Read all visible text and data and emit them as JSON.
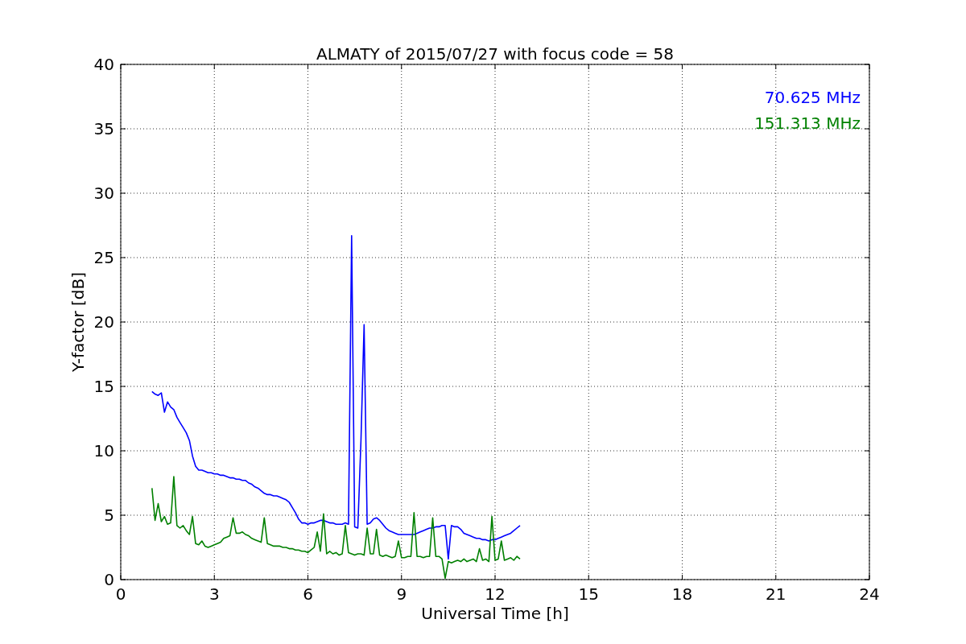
{
  "chart_data": {
    "type": "line",
    "title": "ALMATY of 2015/07/27 with focus code = 58",
    "xlabel": "Universal Time [h]",
    "ylabel": "Y-factor [dB]",
    "grid": true,
    "xlim": [
      0,
      24
    ],
    "ylim": [
      0,
      40
    ],
    "xticks": [
      0,
      3,
      6,
      9,
      12,
      15,
      18,
      21,
      24
    ],
    "yticks": [
      0,
      5,
      10,
      15,
      20,
      25,
      30,
      35,
      40
    ],
    "x": [
      1.0,
      1.1,
      1.2,
      1.3,
      1.4,
      1.5,
      1.6,
      1.7,
      1.8,
      1.9,
      2.0,
      2.1,
      2.2,
      2.3,
      2.4,
      2.5,
      2.6,
      2.7,
      2.8,
      2.9,
      3.0,
      3.1,
      3.2,
      3.3,
      3.4,
      3.5,
      3.6,
      3.7,
      3.8,
      3.9,
      4.0,
      4.1,
      4.2,
      4.3,
      4.4,
      4.5,
      4.6,
      4.7,
      4.8,
      4.9,
      5.0,
      5.1,
      5.2,
      5.3,
      5.4,
      5.5,
      5.6,
      5.7,
      5.8,
      5.9,
      6.0,
      6.1,
      6.2,
      6.3,
      6.4,
      6.5,
      6.6,
      6.7,
      6.8,
      6.9,
      7.0,
      7.1,
      7.2,
      7.3,
      7.4,
      7.5,
      7.6,
      7.7,
      7.8,
      7.9,
      8.0,
      8.1,
      8.2,
      8.3,
      8.4,
      8.5,
      8.6,
      8.7,
      8.8,
      8.9,
      9.0,
      9.1,
      9.2,
      9.3,
      9.4,
      9.5,
      9.6,
      9.7,
      9.8,
      9.9,
      10.0,
      10.1,
      10.2,
      10.3,
      10.4,
      10.5,
      10.6,
      10.7,
      10.8,
      10.9,
      11.0,
      11.1,
      11.2,
      11.3,
      11.4,
      11.5,
      11.6,
      11.7,
      11.8,
      11.9,
      12.0,
      12.1,
      12.2,
      12.3,
      12.4,
      12.5,
      12.6,
      12.7,
      12.8
    ],
    "series": [
      {
        "name": "70.625 MHz",
        "color": "#0000ff",
        "values": [
          14.6,
          14.4,
          14.3,
          14.5,
          13.0,
          13.8,
          13.4,
          13.2,
          12.6,
          12.2,
          11.8,
          11.4,
          10.8,
          9.6,
          8.8,
          8.5,
          8.5,
          8.4,
          8.3,
          8.3,
          8.2,
          8.2,
          8.1,
          8.1,
          8.0,
          7.9,
          7.9,
          7.8,
          7.8,
          7.7,
          7.7,
          7.5,
          7.4,
          7.2,
          7.1,
          6.9,
          6.7,
          6.6,
          6.6,
          6.5,
          6.5,
          6.4,
          6.3,
          6.2,
          6.0,
          5.6,
          5.2,
          4.7,
          4.4,
          4.4,
          4.3,
          4.4,
          4.4,
          4.5,
          4.6,
          4.6,
          4.5,
          4.4,
          4.4,
          4.3,
          4.3,
          4.3,
          4.4,
          4.3,
          26.7,
          4.1,
          4.0,
          10.8,
          19.8,
          4.3,
          4.4,
          4.7,
          4.8,
          4.6,
          4.3,
          4.0,
          3.8,
          3.7,
          3.6,
          3.5,
          3.5,
          3.5,
          3.5,
          3.5,
          3.5,
          3.6,
          3.7,
          3.8,
          3.9,
          4.0,
          4.0,
          4.1,
          4.1,
          4.2,
          4.2,
          1.6,
          4.2,
          4.1,
          4.1,
          3.9,
          3.6,
          3.5,
          3.4,
          3.3,
          3.2,
          3.2,
          3.1,
          3.1,
          3.0,
          3.1,
          3.1,
          3.2,
          3.3,
          3.4,
          3.5,
          3.6,
          3.8,
          4.0,
          4.2
        ]
      },
      {
        "name": "151.313 MHz",
        "color": "#008000",
        "values": [
          7.1,
          4.6,
          5.9,
          4.5,
          4.9,
          4.3,
          4.4,
          8.0,
          4.2,
          4.0,
          4.2,
          3.8,
          3.5,
          4.9,
          2.8,
          2.7,
          3.0,
          2.6,
          2.5,
          2.6,
          2.7,
          2.8,
          2.9,
          3.2,
          3.3,
          3.4,
          4.8,
          3.6,
          3.6,
          3.7,
          3.5,
          3.4,
          3.2,
          3.1,
          3.0,
          2.9,
          4.8,
          2.8,
          2.7,
          2.6,
          2.6,
          2.6,
          2.5,
          2.5,
          2.4,
          2.4,
          2.3,
          2.3,
          2.2,
          2.2,
          2.1,
          2.3,
          2.5,
          3.7,
          2.2,
          5.1,
          2.0,
          2.2,
          2.0,
          2.1,
          1.9,
          2.0,
          4.2,
          2.1,
          2.0,
          1.9,
          2.0,
          2.0,
          1.9,
          4.0,
          2.0,
          2.0,
          3.9,
          1.9,
          1.8,
          1.9,
          1.8,
          1.7,
          1.8,
          3.0,
          1.7,
          1.7,
          1.8,
          1.8,
          5.2,
          1.8,
          1.8,
          1.7,
          1.8,
          1.8,
          4.8,
          1.8,
          1.8,
          1.6,
          0.1,
          1.4,
          1.3,
          1.4,
          1.5,
          1.4,
          1.6,
          1.4,
          1.5,
          1.6,
          1.4,
          2.4,
          1.5,
          1.6,
          1.4,
          4.9,
          1.5,
          1.6,
          3.0,
          1.5,
          1.6,
          1.7,
          1.5,
          1.8,
          1.6
        ]
      }
    ]
  }
}
